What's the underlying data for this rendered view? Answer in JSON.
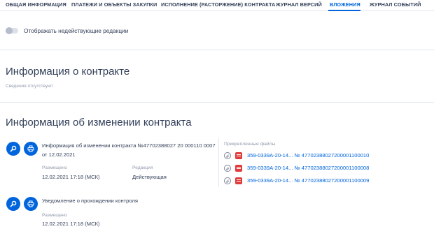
{
  "tabs": [
    {
      "label": "ОБЩАЯ ИНФОРМАЦИЯ",
      "active": false
    },
    {
      "label": "ПЛАТЕЖИ И ОБЪЕКТЫ ЗАКУПКИ",
      "active": false
    },
    {
      "label": "ИСПОЛНЕНИЕ (РАСТОРЖЕНИЕ) КОНТРАКТА",
      "active": false
    },
    {
      "label": "ЖУРНАЛ ВЕРСИЙ",
      "active": false
    },
    {
      "label": "ВЛОЖЕНИЯ",
      "active": true
    },
    {
      "label": "ЖУРНАЛ СОБЫТИЙ",
      "active": false
    }
  ],
  "toggle": {
    "label": "Отображать недействующие редакции",
    "on": false
  },
  "contract_info": {
    "title": "Информация о контракте",
    "empty_text": "Сведения отсутствуют"
  },
  "changes": {
    "title": "Информация об изменении контракта",
    "doc1": {
      "title": "Информация об изменении контракта №47702388027 20 000110 0007 от 12.02.2021",
      "posted_label": "Размещено",
      "posted_value": "12.02.2021 17:18 (МСК)",
      "edition_label": "Редакция",
      "edition_value": "Действующая"
    },
    "attached_label": "Прикрепленные файлы",
    "files": [
      "359-0339А-20-14... № 4770238802720000110001​0",
      "359-0339А-20-14... № 4770238802720000110000​8",
      "359-0339А-20-14... № 4770238802720000110000​9"
    ],
    "doc2": {
      "title": "Уведомление о прохождении контроля",
      "posted_label": "Размещено",
      "posted_value": "12.02.2021 17:18 (МСК)"
    }
  },
  "icons": {
    "search": "magnifier-icon",
    "print": "printer-icon",
    "attach": "paperclip-icon",
    "pdf": "pdf-file-icon"
  },
  "colors": {
    "accent": "#0065dd",
    "text": "#334059",
    "muted": "#919aae",
    "pdf": "#e03c3c"
  }
}
